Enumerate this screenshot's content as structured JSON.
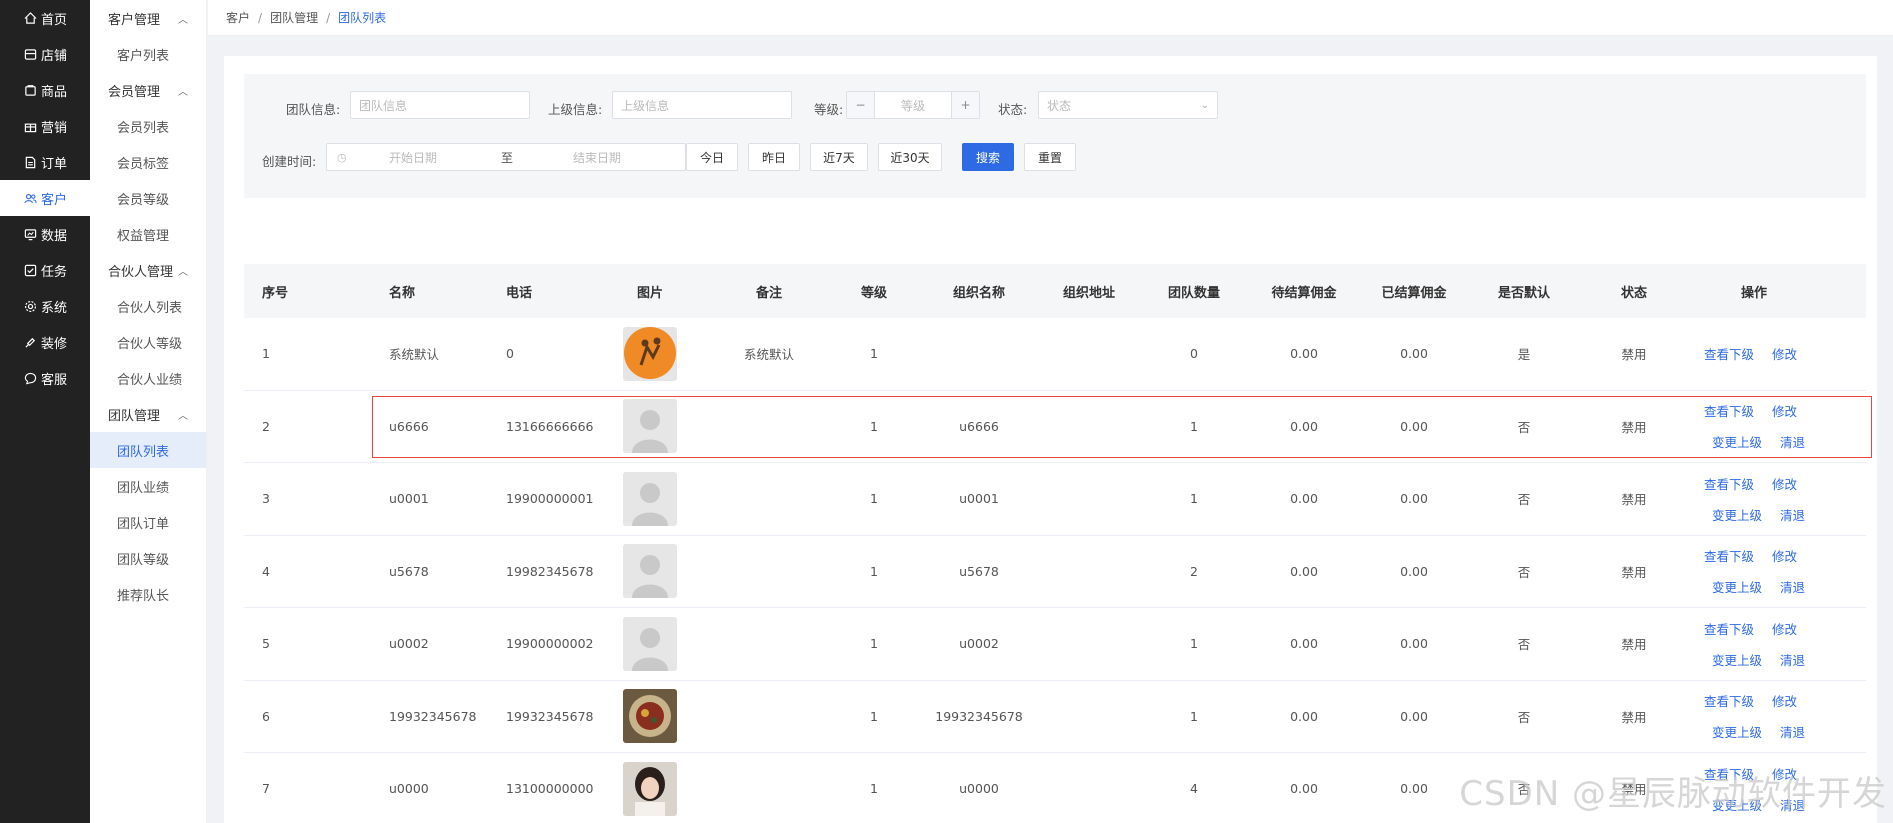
{
  "nav": [
    {
      "label": "首页",
      "icon": "home-icon"
    },
    {
      "label": "店铺",
      "icon": "store-icon"
    },
    {
      "label": "商品",
      "icon": "goods-icon"
    },
    {
      "label": "营销",
      "icon": "gift-icon"
    },
    {
      "label": "订单",
      "icon": "order-icon"
    },
    {
      "label": "客户",
      "icon": "customer-icon",
      "active": true
    },
    {
      "label": "数据",
      "icon": "data-icon"
    },
    {
      "label": "任务",
      "icon": "task-icon"
    },
    {
      "label": "系统",
      "icon": "gear-icon"
    },
    {
      "label": "装修",
      "icon": "decorate-icon"
    },
    {
      "label": "客服",
      "icon": "chat-icon"
    }
  ],
  "subnav": {
    "groups": [
      {
        "label": "客户管理",
        "items": [
          "客户列表"
        ]
      },
      {
        "label": "会员管理",
        "items": [
          "会员列表",
          "会员标签",
          "会员等级",
          "权益管理"
        ]
      },
      {
        "label": "合伙人管理",
        "items": [
          "合伙人列表",
          "合伙人等级",
          "合伙人业绩"
        ]
      },
      {
        "label": "团队管理",
        "items": [
          "团队列表",
          "团队业绩",
          "团队订单",
          "团队等级",
          "推荐队长"
        ]
      }
    ],
    "active": "团队列表"
  },
  "breadcrumb": [
    "客户",
    "团队管理",
    "团队列表"
  ],
  "filter": {
    "team_info_label": "团队信息:",
    "team_info_placeholder": "团队信息",
    "parent_label": "上级信息:",
    "parent_placeholder": "上级信息",
    "level_label": "等级:",
    "level_placeholder": "等级",
    "status_label": "状态:",
    "status_placeholder": "状态",
    "created_label": "创建时间:",
    "start_placeholder": "开始日期",
    "range_sep": "至",
    "end_placeholder": "结束日期",
    "quick": [
      "今日",
      "昨日",
      "近7天",
      "近30天"
    ],
    "search_btn": "搜索",
    "reset_btn": "重置"
  },
  "table": {
    "headers": [
      "序号",
      "名称",
      "电话",
      "图片",
      "备注",
      "等级",
      "组织名称",
      "组织地址",
      "团队数量",
      "待结算佣金",
      "已结算佣金",
      "是否默认",
      "状态",
      "操作"
    ],
    "rows": [
      {
        "no": "1",
        "name": "系统默认",
        "phone": "0",
        "img": "orange-logo",
        "note": "系统默认",
        "level": "1",
        "org": "",
        "addr": "",
        "count": "0",
        "pending": "0.00",
        "settled": "0.00",
        "default": "是",
        "status": "禁用",
        "ops": [
          "查看下级",
          "修改"
        ]
      },
      {
        "no": "2",
        "name": "u6666",
        "phone": "13166666666",
        "img": "avatar-default",
        "note": "",
        "level": "1",
        "org": "u6666",
        "addr": "",
        "count": "1",
        "pending": "0.00",
        "settled": "0.00",
        "default": "否",
        "status": "禁用",
        "ops": [
          "查看下级",
          "修改",
          "变更上级",
          "清退"
        ]
      },
      {
        "no": "3",
        "name": "u0001",
        "phone": "19900000001",
        "img": "avatar-default",
        "note": "",
        "level": "1",
        "org": "u0001",
        "addr": "",
        "count": "1",
        "pending": "0.00",
        "settled": "0.00",
        "default": "否",
        "status": "禁用",
        "ops": [
          "查看下级",
          "修改",
          "变更上级",
          "清退"
        ]
      },
      {
        "no": "4",
        "name": "u5678",
        "phone": "19982345678",
        "img": "avatar-default",
        "note": "",
        "level": "1",
        "org": "u5678",
        "addr": "",
        "count": "2",
        "pending": "0.00",
        "settled": "0.00",
        "default": "否",
        "status": "禁用",
        "ops": [
          "查看下级",
          "修改",
          "变更上级",
          "清退"
        ]
      },
      {
        "no": "5",
        "name": "u0002",
        "phone": "19900000002",
        "img": "avatar-default",
        "note": "",
        "level": "1",
        "org": "u0002",
        "addr": "",
        "count": "1",
        "pending": "0.00",
        "settled": "0.00",
        "default": "否",
        "status": "禁用",
        "ops": [
          "查看下级",
          "修改",
          "变更上级",
          "清退"
        ]
      },
      {
        "no": "6",
        "name": "19932345678",
        "phone": "19932345678",
        "img": "photo-bowl",
        "note": "",
        "level": "1",
        "org": "19932345678",
        "addr": "",
        "count": "1",
        "pending": "0.00",
        "settled": "0.00",
        "default": "否",
        "status": "禁用",
        "ops": [
          "查看下级",
          "修改",
          "变更上级",
          "清退"
        ]
      },
      {
        "no": "7",
        "name": "u0000",
        "phone": "13100000000",
        "img": "photo-girl",
        "note": "",
        "level": "1",
        "org": "u0000",
        "addr": "",
        "count": "4",
        "pending": "0.00",
        "settled": "0.00",
        "default": "否",
        "status": "禁用",
        "ops": [
          "查看下级",
          "修改",
          "变更上级",
          "清退"
        ]
      }
    ]
  },
  "watermark": "CSDN @星辰脉动软件开发",
  "colors": {
    "accent": "#2d6ae3",
    "nav_bg": "#222222",
    "highlight": "#e8473a"
  }
}
